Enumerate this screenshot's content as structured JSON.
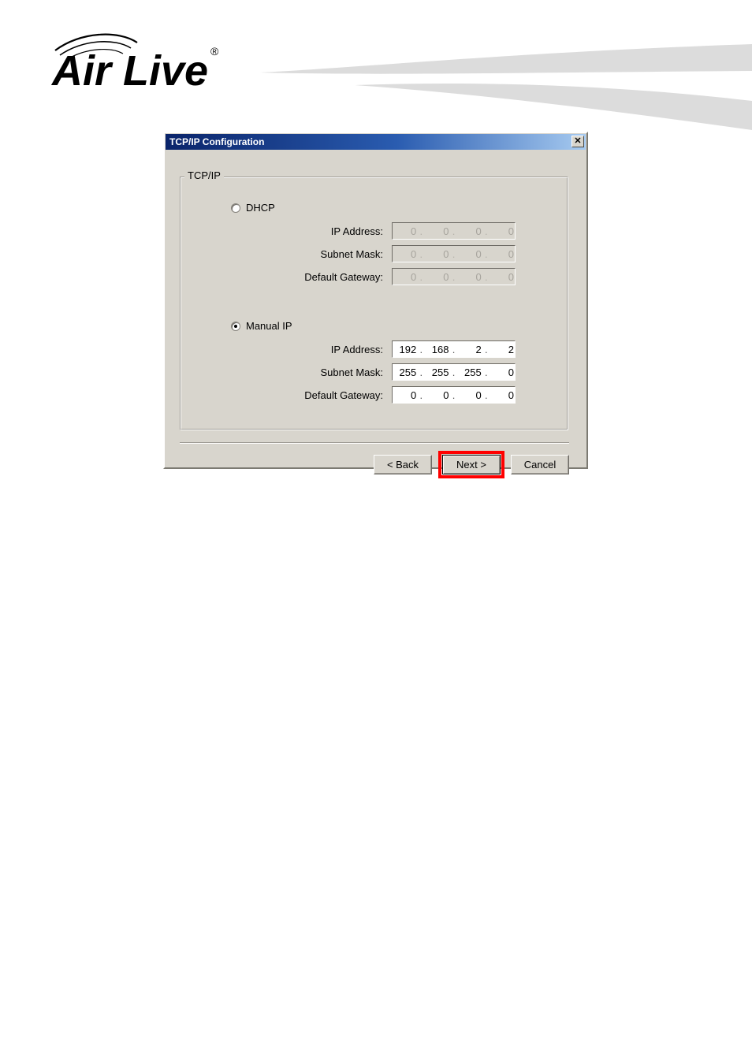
{
  "brand": {
    "name": "Air Live",
    "trademark": "®",
    "logo_icon": "airlive-wireless-logo",
    "swoosh_icon": "swoosh-ribbon-graphic",
    "swoosh_color": "#dcdcdc"
  },
  "dialog": {
    "title": "TCP/IP Configuration",
    "close_icon": "close-x-icon",
    "close_label": "✕",
    "titlebar_color_start": "#0a246a",
    "titlebar_color_end": "#a6caf0",
    "face_color": "#d8d5cd",
    "groupbox": {
      "legend": "TCP/IP"
    },
    "options": [
      {
        "id": "dhcp",
        "label": "DHCP",
        "selected": false,
        "enabled": false,
        "fields": [
          {
            "id": "dhcp-ip-address",
            "label": "IP Address:",
            "octets": [
              "0",
              "0",
              "0",
              "0"
            ]
          },
          {
            "id": "dhcp-subnet-mask",
            "label": "Subnet Mask:",
            "octets": [
              "0",
              "0",
              "0",
              "0"
            ]
          },
          {
            "id": "dhcp-default-gateway",
            "label": "Default Gateway:",
            "octets": [
              "0",
              "0",
              "0",
              "0"
            ]
          }
        ]
      },
      {
        "id": "manual",
        "label": "Manual IP",
        "selected": true,
        "enabled": true,
        "fields": [
          {
            "id": "manual-ip-address",
            "label": "IP Address:",
            "octets": [
              "192",
              "168",
              "2",
              "2"
            ]
          },
          {
            "id": "manual-subnet-mask",
            "label": "Subnet Mask:",
            "octets": [
              "255",
              "255",
              "255",
              "0"
            ]
          },
          {
            "id": "manual-default-gateway",
            "label": "Default Gateway:",
            "octets": [
              "0",
              "0",
              "0",
              "0"
            ]
          }
        ]
      }
    ],
    "octet_separator": ".",
    "buttons": {
      "back": "< Back",
      "next": "Next >",
      "cancel": "Cancel"
    },
    "annotation": {
      "target": "next-button",
      "color": "#ff0000"
    }
  }
}
